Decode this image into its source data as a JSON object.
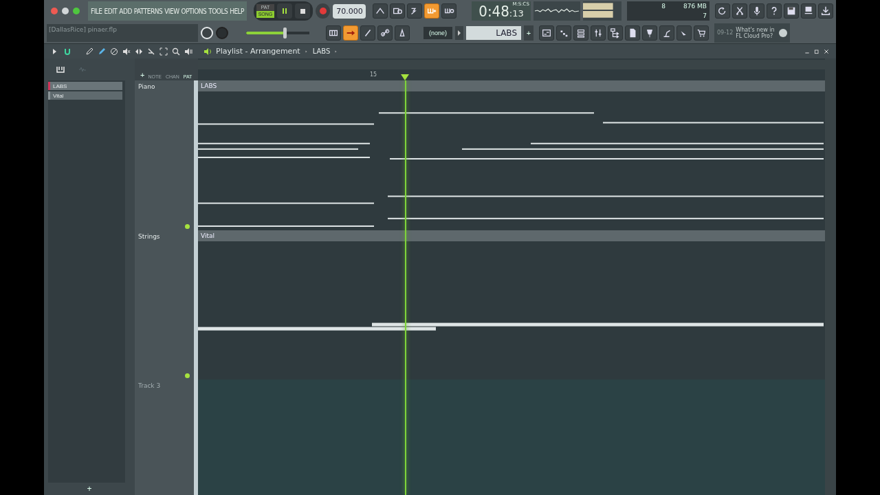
{
  "menu": [
    "FILE",
    "EDIT",
    "ADD",
    "PATTERNS",
    "VIEW",
    "OPTIONS",
    "TOOLS",
    "HELP"
  ],
  "transport": {
    "modes": [
      {
        "label": "PAT",
        "selected": false
      },
      {
        "label": "SONG",
        "selected": true
      }
    ],
    "playing": true,
    "tempo": "70.000"
  },
  "tool_buttons_top": [
    {
      "on": false
    },
    {
      "on": false
    },
    {
      "on": false
    },
    {
      "on": true
    },
    {
      "on": false
    }
  ],
  "time": {
    "main": "0:48",
    "sub": ":13",
    "format": "M:S:CS"
  },
  "memory": {
    "cpu": "8",
    "ram": "876 MB",
    "polyphony": "7"
  },
  "project": {
    "title": "[DallasRice] pinaer.flp"
  },
  "master_volume": {
    "level": 0.62
  },
  "tool_buttons_bottom": [
    {
      "on": false
    },
    {
      "on": true
    },
    {
      "on": false
    },
    {
      "on": false
    },
    {
      "on": false
    }
  ],
  "pattern": {
    "channel": "(none)",
    "name": "LABS",
    "add": "+"
  },
  "news": {
    "date": "09-12",
    "text": "What's new in FL Cloud Pro?"
  },
  "playlist": {
    "title": "Playlist - Arrangement",
    "breadcrumb": "LABS",
    "picker": [
      {
        "label": "LABS",
        "selected": true
      },
      {
        "label": "Vital",
        "selected": false
      }
    ],
    "picker_add": "+",
    "header_tabs": [
      {
        "label": "NOTE",
        "selected": false
      },
      {
        "label": "CHAN",
        "selected": false
      },
      {
        "label": "PAT",
        "selected": true
      }
    ],
    "header_add": "+",
    "ruler": "15",
    "tracks": [
      {
        "name": "Piano",
        "empty": false,
        "clip": {
          "label": "LABS",
          "kind": "keys"
        }
      },
      {
        "name": "Strings",
        "empty": false,
        "clip": {
          "label": "Vital",
          "kind": "pad"
        }
      },
      {
        "name": "Track 3",
        "empty": true
      }
    ]
  }
}
